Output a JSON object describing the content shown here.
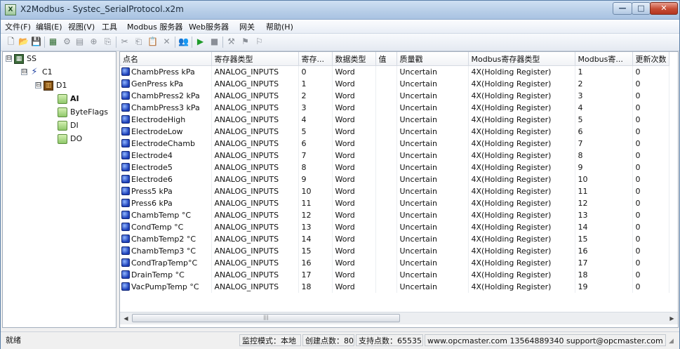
{
  "window": {
    "title": "X2Modbus - Systec_SerialProtocol.x2m",
    "app_icon": "X",
    "controls": {
      "minimize": "—",
      "maximize": "□",
      "close": "✕"
    }
  },
  "menu": [
    "文件(F)",
    "编辑(E)",
    "视图(V)",
    "工具",
    "Modbus 服务器",
    "Web服务器",
    "网关",
    "帮助(H)"
  ],
  "toolbar": [
    {
      "icon": "new-document-icon",
      "glyph": "🗋"
    },
    {
      "icon": "open-folder-icon",
      "glyph": "📂"
    },
    {
      "icon": "save-icon",
      "glyph": "💾"
    },
    {
      "icon": "add-channel-icon",
      "glyph": "▦"
    },
    {
      "icon": "add-device-icon",
      "glyph": "⚙"
    },
    {
      "icon": "add-group-icon",
      "glyph": "▤"
    },
    {
      "icon": "add-tag-icon",
      "glyph": "⊕"
    },
    {
      "icon": "properties-icon",
      "glyph": "⎘"
    },
    {
      "icon": "cut-icon",
      "glyph": "✂"
    },
    {
      "icon": "copy-icon",
      "glyph": "⎗"
    },
    {
      "icon": "paste-icon",
      "glyph": "📋"
    },
    {
      "icon": "delete-icon",
      "glyph": "✕"
    },
    {
      "icon": "users-icon",
      "glyph": "👥"
    },
    {
      "icon": "start-icon",
      "glyph": "▶"
    },
    {
      "icon": "stop-icon",
      "glyph": "■"
    },
    {
      "icon": "import-icon",
      "glyph": "⚒"
    },
    {
      "icon": "export-icon",
      "glyph": "⚑"
    },
    {
      "icon": "config-icon",
      "glyph": "⚐"
    }
  ],
  "tree": {
    "nodes": [
      {
        "label": "SS",
        "icon": "server-icon",
        "level": 0,
        "expander": "⊟"
      },
      {
        "label": "C1",
        "icon": "channel-icon",
        "level": 1,
        "expander": "⊟"
      },
      {
        "label": "D1",
        "icon": "device-icon",
        "level": 2,
        "expander": "⊟"
      },
      {
        "label": "AI",
        "icon": "folder-icon",
        "level": 3,
        "selected": true
      },
      {
        "label": "ByteFlags",
        "icon": "folder-icon",
        "level": 3
      },
      {
        "label": "DI",
        "icon": "folder-icon",
        "level": 3
      },
      {
        "label": "DO",
        "icon": "folder-icon",
        "level": 3
      }
    ]
  },
  "grid": {
    "columns": [
      "点名",
      "寄存器类型",
      "寄存...",
      "数据类型",
      "值",
      "质量戳",
      "Modbus寄存器类型",
      "Modbus寄...",
      "更新次数"
    ],
    "rows": [
      [
        "ChambPress kPa",
        "ANALOG_INPUTS",
        "0",
        "Word",
        "",
        "Uncertain",
        "4X(Holding Register)",
        "1",
        "0"
      ],
      [
        "GenPress kPa",
        "ANALOG_INPUTS",
        "1",
        "Word",
        "",
        "Uncertain",
        "4X(Holding Register)",
        "2",
        "0"
      ],
      [
        "ChambPress2 kPa",
        "ANALOG_INPUTS",
        "2",
        "Word",
        "",
        "Uncertain",
        "4X(Holding Register)",
        "3",
        "0"
      ],
      [
        "ChambPress3 kPa",
        "ANALOG_INPUTS",
        "3",
        "Word",
        "",
        "Uncertain",
        "4X(Holding Register)",
        "4",
        "0"
      ],
      [
        "ElectrodeHigh",
        "ANALOG_INPUTS",
        "4",
        "Word",
        "",
        "Uncertain",
        "4X(Holding Register)",
        "5",
        "0"
      ],
      [
        "ElectrodeLow",
        "ANALOG_INPUTS",
        "5",
        "Word",
        "",
        "Uncertain",
        "4X(Holding Register)",
        "6",
        "0"
      ],
      [
        "ElectrodeChamb",
        "ANALOG_INPUTS",
        "6",
        "Word",
        "",
        "Uncertain",
        "4X(Holding Register)",
        "7",
        "0"
      ],
      [
        "Electrode4",
        "ANALOG_INPUTS",
        "7",
        "Word",
        "",
        "Uncertain",
        "4X(Holding Register)",
        "8",
        "0"
      ],
      [
        "Electrode5",
        "ANALOG_INPUTS",
        "8",
        "Word",
        "",
        "Uncertain",
        "4X(Holding Register)",
        "9",
        "0"
      ],
      [
        "Electrode6",
        "ANALOG_INPUTS",
        "9",
        "Word",
        "",
        "Uncertain",
        "4X(Holding Register)",
        "10",
        "0"
      ],
      [
        "Press5 kPa",
        "ANALOG_INPUTS",
        "10",
        "Word",
        "",
        "Uncertain",
        "4X(Holding Register)",
        "11",
        "0"
      ],
      [
        "Press6 kPa",
        "ANALOG_INPUTS",
        "11",
        "Word",
        "",
        "Uncertain",
        "4X(Holding Register)",
        "12",
        "0"
      ],
      [
        "ChambTemp °C",
        "ANALOG_INPUTS",
        "12",
        "Word",
        "",
        "Uncertain",
        "4X(Holding Register)",
        "13",
        "0"
      ],
      [
        "CondTemp °C",
        "ANALOG_INPUTS",
        "13",
        "Word",
        "",
        "Uncertain",
        "4X(Holding Register)",
        "14",
        "0"
      ],
      [
        "ChambTemp2 °C",
        "ANALOG_INPUTS",
        "14",
        "Word",
        "",
        "Uncertain",
        "4X(Holding Register)",
        "15",
        "0"
      ],
      [
        "ChambTemp3 °C",
        "ANALOG_INPUTS",
        "15",
        "Word",
        "",
        "Uncertain",
        "4X(Holding Register)",
        "16",
        "0"
      ],
      [
        "CondTrapTemp°C",
        "ANALOG_INPUTS",
        "16",
        "Word",
        "",
        "Uncertain",
        "4X(Holding Register)",
        "17",
        "0"
      ],
      [
        "DrainTemp °C",
        "ANALOG_INPUTS",
        "17",
        "Word",
        "",
        "Uncertain",
        "4X(Holding Register)",
        "18",
        "0"
      ],
      [
        "VacPumpTemp °C",
        "ANALOG_INPUTS",
        "18",
        "Word",
        "",
        "Uncertain",
        "4X(Holding Register)",
        "19",
        "0"
      ]
    ]
  },
  "scrollbar": {
    "left_arrow": "◀",
    "right_arrow": "▶",
    "thumb_grip": "|||"
  },
  "status": {
    "ready": "就绪",
    "mode": "监控模式：本地",
    "created_points": "创建点数：80",
    "supported_points": "支持点数：65535",
    "contact": "www.opcmaster.com 13564889340 support@opcmaster.com"
  },
  "colors": {
    "title_bar": "#b6cde7",
    "close_button": "#c64b33",
    "tag_icon": "#1d3fb8",
    "folder_icon": "#8fc86a"
  }
}
